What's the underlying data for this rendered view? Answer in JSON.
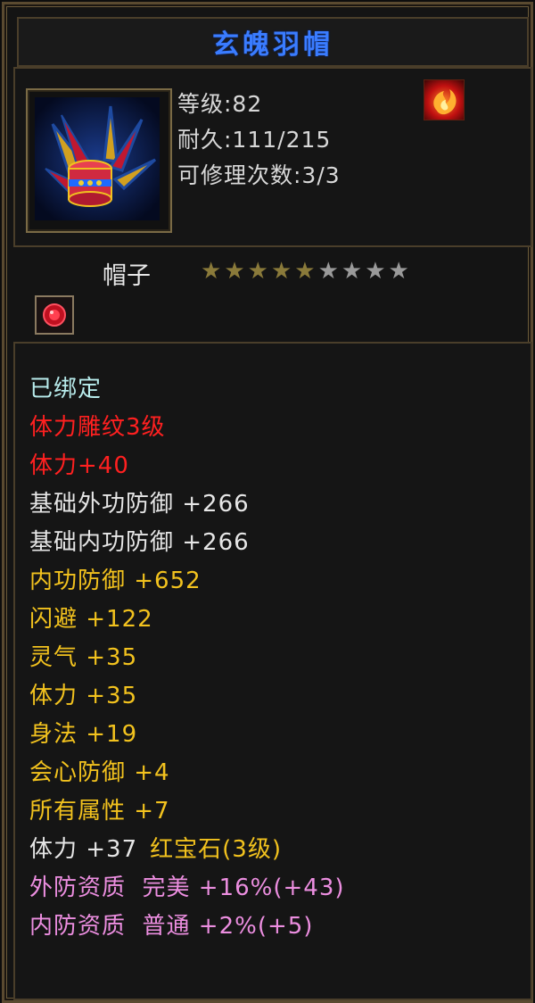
{
  "title": "玄魄羽帽",
  "header": {
    "level": "等级:82",
    "durability": "耐久:111/215",
    "repair": "可修理次数:3/3",
    "fire_icon": "fire-emblem-icon"
  },
  "item_type": "帽子",
  "stars": {
    "filled": 5,
    "total": 9
  },
  "gem_icon": "red-gem-socket-icon",
  "colors": {
    "title": "#3a7cff",
    "bound": "#b8ecec",
    "red": "#ff2020",
    "white": "#e6e6e6",
    "yellow": "#f2c21e",
    "pink": "#ec8ee0"
  },
  "attributes": [
    {
      "text": "已绑定",
      "color": "bound"
    },
    {
      "text": "体力雕纹3级",
      "color": "red"
    },
    {
      "text": "体力+40",
      "color": "red"
    },
    {
      "text": "基础外功防御 +266",
      "color": "white"
    },
    {
      "text": "基础内功防御 +266",
      "color": "white"
    },
    {
      "text": "内功防御 +652",
      "color": "yellow"
    },
    {
      "text": "闪避 +122",
      "color": "yellow"
    },
    {
      "text": "灵气 +35",
      "color": "yellow"
    },
    {
      "text": "体力 +35",
      "color": "yellow"
    },
    {
      "text": "身法 +19",
      "color": "yellow"
    },
    {
      "text": "会心防御 +4",
      "color": "yellow"
    },
    {
      "text": "所有属性 +7",
      "color": "yellow"
    }
  ],
  "gem_line": {
    "stat": "体力 +37",
    "gem": "红宝石(3级)"
  },
  "quality": [
    {
      "text": "外防资质  完美 +16%(+43)",
      "color": "pink"
    },
    {
      "text": "内防资质  普通 +2%(+5)",
      "color": "pink"
    }
  ]
}
